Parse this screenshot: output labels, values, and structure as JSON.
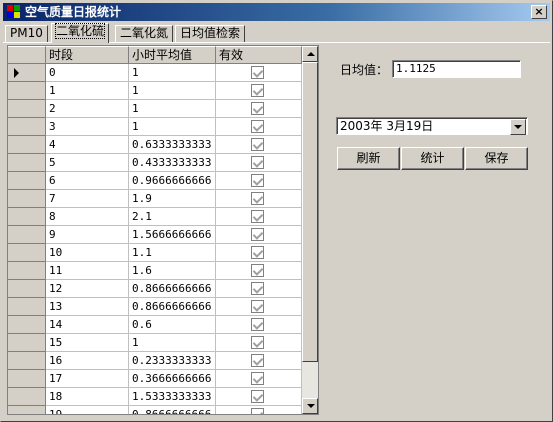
{
  "window": {
    "title": "空气质量日报统计",
    "close_glyph": "×"
  },
  "tabs": [
    {
      "label": "PM10",
      "active": false
    },
    {
      "label": "二氧化硫",
      "active": true
    },
    {
      "label": "二氧化氮",
      "active": false
    },
    {
      "label": "日均值检索",
      "active": false
    }
  ],
  "grid": {
    "columns": [
      "时段",
      "小时平均值",
      "有效"
    ],
    "rows": [
      {
        "period": "0",
        "avg": "1",
        "valid": true
      },
      {
        "period": "1",
        "avg": "1",
        "valid": true
      },
      {
        "period": "2",
        "avg": "1",
        "valid": true
      },
      {
        "period": "3",
        "avg": "1",
        "valid": true
      },
      {
        "period": "4",
        "avg": "0.6333333333",
        "valid": true
      },
      {
        "period": "5",
        "avg": "0.4333333333",
        "valid": true
      },
      {
        "period": "6",
        "avg": "0.9666666666",
        "valid": true
      },
      {
        "period": "7",
        "avg": "1.9",
        "valid": true
      },
      {
        "period": "8",
        "avg": "2.1",
        "valid": true
      },
      {
        "period": "9",
        "avg": "1.5666666666",
        "valid": true
      },
      {
        "period": "10",
        "avg": "1.1",
        "valid": true
      },
      {
        "period": "11",
        "avg": "1.6",
        "valid": true
      },
      {
        "period": "12",
        "avg": "0.8666666666",
        "valid": true
      },
      {
        "period": "13",
        "avg": "0.8666666666",
        "valid": true
      },
      {
        "period": "14",
        "avg": "0.6",
        "valid": true
      },
      {
        "period": "15",
        "avg": "1",
        "valid": true
      },
      {
        "period": "16",
        "avg": "0.2333333333",
        "valid": true
      },
      {
        "period": "17",
        "avg": "0.3666666666",
        "valid": true
      },
      {
        "period": "18",
        "avg": "1.5333333333",
        "valid": true
      },
      {
        "period": "19",
        "avg": "0.8666666666",
        "valid": true
      }
    ]
  },
  "daily_avg": {
    "label": "日均值：",
    "value": "1.1125"
  },
  "date_select": {
    "value": "2003年 3月19日"
  },
  "buttons": {
    "refresh": "刷新",
    "stats": "统计",
    "save": "保存"
  },
  "colors": {
    "titlebar_start": "#0a246a",
    "titlebar_end": "#a6caf0",
    "face": "#d4d0c8"
  }
}
